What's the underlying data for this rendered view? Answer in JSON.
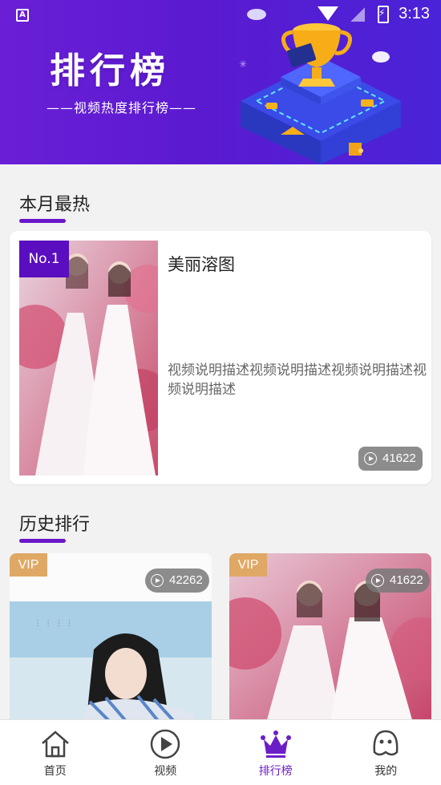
{
  "status_bar": {
    "time": "3:13"
  },
  "banner": {
    "title": "排行榜",
    "subtitle": "——视频热度排行榜——"
  },
  "monthly": {
    "section_title": "本月最热",
    "rank_label": "No.1",
    "name": "美丽溶图",
    "description": "视频说明描述视频说明描述视频说明描述视频说明描述",
    "play_count": "41622"
  },
  "history": {
    "section_title": "历史排行",
    "cards": [
      {
        "badge": "VIP",
        "play_count": "42262"
      },
      {
        "badge": "VIP",
        "play_count": "41622"
      }
    ]
  },
  "nav": {
    "items": [
      {
        "label": "首页",
        "icon": "home-icon"
      },
      {
        "label": "视频",
        "icon": "video-play-icon"
      },
      {
        "label": "排行榜",
        "icon": "crown-icon"
      },
      {
        "label": "我的",
        "icon": "profile-icon"
      }
    ],
    "active_index": 2,
    "active_color": "#6c1ec6"
  },
  "colors": {
    "banner_gradient_start": "#6a1fd6",
    "accent_purple": "#5a0ec0",
    "vip_badge": "#e0a865"
  }
}
